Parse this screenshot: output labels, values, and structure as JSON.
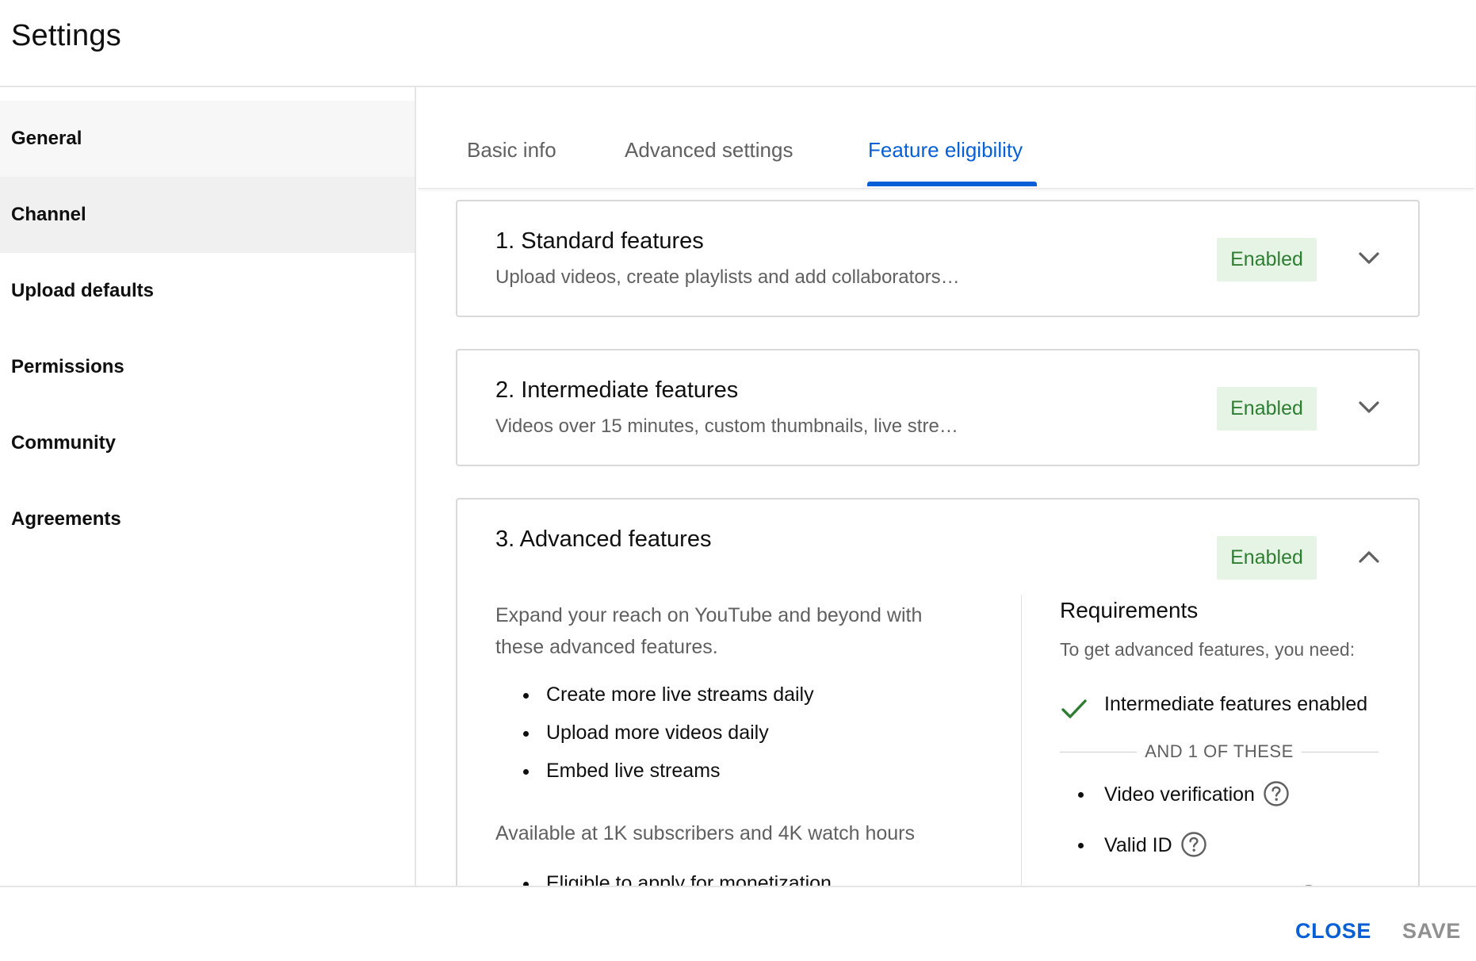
{
  "header": {
    "title": "Settings"
  },
  "sidebar": {
    "items": [
      {
        "label": "General"
      },
      {
        "label": "Channel"
      },
      {
        "label": "Upload defaults"
      },
      {
        "label": "Permissions"
      },
      {
        "label": "Community"
      },
      {
        "label": "Agreements"
      }
    ],
    "active": "Channel"
  },
  "tabs": [
    {
      "label": "Basic info"
    },
    {
      "label": "Advanced settings"
    },
    {
      "label": "Feature eligibility"
    }
  ],
  "active_tab": "Feature eligibility",
  "features": [
    {
      "title": "1. Standard features",
      "subtitle": "Upload videos, create playlists and add collaborators…",
      "status": "Enabled",
      "expanded": false,
      "chevron": "chevron-down-icon"
    },
    {
      "title": "2. Intermediate features",
      "subtitle": "Videos over 15 minutes, custom thumbnails, live stre…",
      "status": "Enabled",
      "expanded": false,
      "chevron": "chevron-down-icon"
    },
    {
      "title": "3. Advanced features",
      "status": "Enabled",
      "expanded": true,
      "chevron": "chevron-up-icon",
      "description": "Expand your reach on YouTube and beyond with these advanced features.",
      "benefits": [
        "Create more live streams daily",
        "Upload more videos daily",
        "Embed live streams"
      ],
      "availability": "Available at 1K subscribers and 4K watch hours",
      "more_benefits": [
        "Eligible to apply for monetization"
      ],
      "requirements": {
        "title": "Requirements",
        "subtitle": "To get advanced features, you need:",
        "met": "Intermediate features enabled",
        "separator": "AND 1 OF THESE",
        "options": [
          "Video verification",
          "Valid ID"
        ]
      }
    }
  ],
  "footer": {
    "close": "CLOSE",
    "save": "SAVE"
  },
  "colors": {
    "accent": "#065fd4",
    "enabled_text": "#2e7d32",
    "enabled_bg": "#e6f4e6",
    "muted": "#606060",
    "disabled": "#909090"
  }
}
